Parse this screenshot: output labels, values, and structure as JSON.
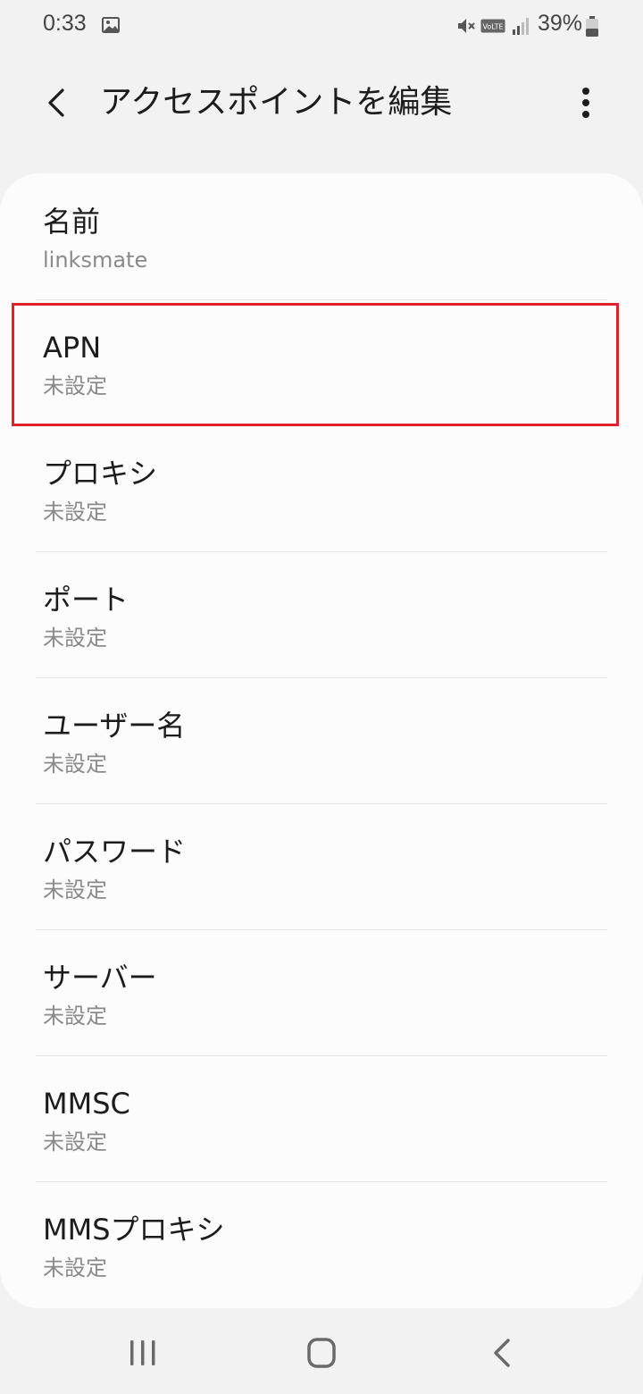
{
  "status_bar": {
    "time": "0:33",
    "battery_percent": "39%",
    "icons": [
      "gallery-icon",
      "mute-icon",
      "volte-icon",
      "signal-icon",
      "battery-icon"
    ],
    "volte_label": "VoLTE"
  },
  "header": {
    "title": "アクセスポイントを編集",
    "back_icon": "back-arrow-icon",
    "more_icon": "more-vert-icon"
  },
  "settings": [
    {
      "title": "名前",
      "value": "linksmate"
    },
    {
      "title": "APN",
      "value": "未設定",
      "highlighted": true
    },
    {
      "title": "プロキシ",
      "value": "未設定"
    },
    {
      "title": "ポート",
      "value": "未設定"
    },
    {
      "title": "ユーザー名",
      "value": "未設定"
    },
    {
      "title": "パスワード",
      "value": "未設定"
    },
    {
      "title": "サーバー",
      "value": "未設定"
    },
    {
      "title": "MMSC",
      "value": "未設定"
    },
    {
      "title": "MMSプロキシ",
      "value": "未設定"
    }
  ],
  "highlight_color": "#e0202a",
  "nav_bar": {
    "icons": [
      "recents-icon",
      "home-icon",
      "back-icon"
    ]
  }
}
